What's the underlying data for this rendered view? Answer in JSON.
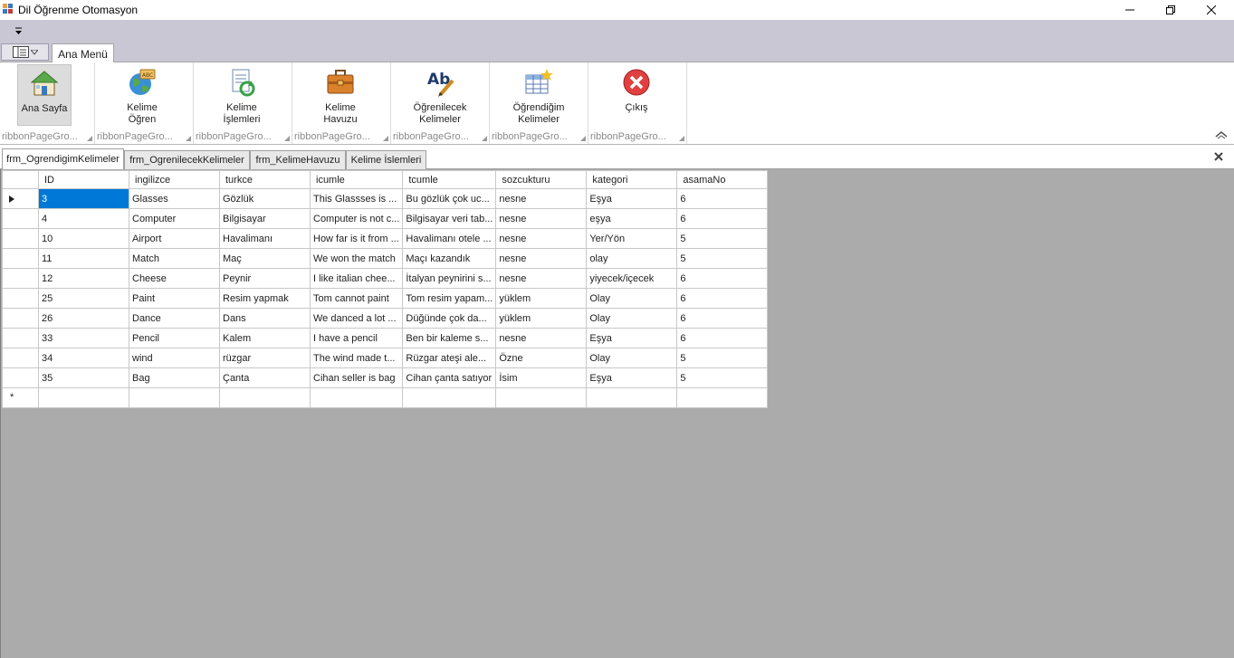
{
  "window": {
    "title": "Dil Öğrenme Otomasyon"
  },
  "ribbon": {
    "tab": "Ana Menü",
    "groups": [
      {
        "button": "Ana Sayfa",
        "icon": "home-icon",
        "caption": "ribbonPageGro..."
      },
      {
        "button": "Kelime\nÖğren",
        "icon": "globe-abc-icon",
        "caption": "ribbonPageGro..."
      },
      {
        "button": "Kelime\nİşlemleri",
        "icon": "document-refresh-icon",
        "caption": "ribbonPageGro..."
      },
      {
        "button": "Kelime\nHavuzu",
        "icon": "briefcase-icon",
        "caption": "ribbonPageGro..."
      },
      {
        "button": "Öğrenilecek\nKelimeler",
        "icon": "spelling-pen-icon",
        "caption": "ribbonPageGro..."
      },
      {
        "button": "Öğrendiğim\nKelimeler",
        "icon": "table-star-icon",
        "caption": "ribbonPageGro..."
      },
      {
        "button": "Çıkış",
        "icon": "close-circle-icon",
        "caption": "ribbonPageGro..."
      }
    ]
  },
  "mdi_tabs": [
    "frm_OgrendigimKelimeler",
    "frm_OgrenilecekKelimeler",
    "frm_KelimeHavuzu",
    "Kelime İslemleri"
  ],
  "grid": {
    "columns": [
      "ID",
      "ingilizce",
      "turkce",
      "icumle",
      "tcumle",
      "sozcukturu",
      "kategori",
      "asamaNo"
    ],
    "rows": [
      [
        "3",
        "Glasses",
        "Gözlük",
        "This Glassses is ...",
        "Bu gözlük çok uc...",
        "nesne",
        "Eşya",
        "6"
      ],
      [
        "4",
        "Computer",
        "Bilgisayar",
        "Computer is not c...",
        "Bilgisayar veri tab...",
        "nesne",
        "eşya",
        "6"
      ],
      [
        "10",
        "Airport",
        "Havalimanı",
        "How far is it from ...",
        "Havalimanı otele ...",
        "nesne",
        "Yer/Yön",
        "5"
      ],
      [
        "11",
        "Match",
        "Maç",
        "We won the match",
        "Maçı kazandık",
        "nesne",
        "olay",
        "5"
      ],
      [
        "12",
        "Cheese",
        "Peynir",
        "I like italian chee...",
        "İtalyan peynirini s...",
        "nesne",
        "yiyecek/içecek",
        "6"
      ],
      [
        "25",
        "Paint",
        "Resim yapmak",
        "Tom cannot paint",
        "Tom resim yapam...",
        "yüklem",
        "Olay",
        "6"
      ],
      [
        "26",
        "Dance",
        "Dans",
        "We danced a lot ...",
        "Düğünde çok da...",
        "yüklem",
        "Olay",
        "6"
      ],
      [
        "33",
        "Pencil",
        "Kalem",
        "I have a pencil",
        "Ben bir kaleme s...",
        "nesne",
        "Eşya",
        "6"
      ],
      [
        "34",
        "wind",
        "rüzgar",
        "The wind made t...",
        "Rüzgar  ateşi ale...",
        "Özne",
        "Olay",
        "5"
      ],
      [
        "35",
        "Bag",
        "Çanta",
        "Cihan seller is bag",
        "Cihan çanta satıyor",
        "İsim",
        "Eşya",
        "5"
      ]
    ],
    "new_row_marker": "*"
  },
  "colors": {
    "selection": "#0078d7",
    "ribbon_chrome": "#c8c7d3",
    "grid_background": "#ababab"
  }
}
